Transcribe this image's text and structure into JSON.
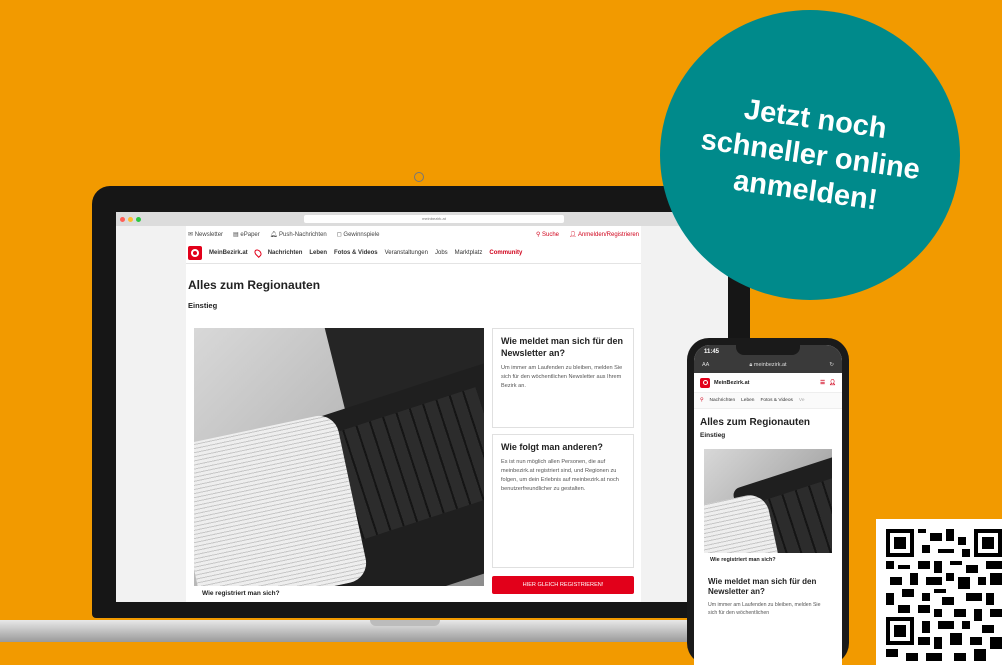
{
  "colors": {
    "background": "#f29a00",
    "badge": "#008a8b",
    "brand_red": "#e2001a"
  },
  "badge": {
    "line1": "Jetzt noch",
    "line2": "schneller online",
    "line3": "anmelden!"
  },
  "browser": {
    "url": "meinbezirk.at"
  },
  "site": {
    "topbar": {
      "newsletter": "Newsletter",
      "epaper": "ePaper",
      "push": "Push-Nachrichten",
      "gewinnspiele": "Gewinnspiele",
      "suche": "Suche",
      "anmelden": "Anmelden/Registrieren"
    },
    "logo": "MeinBezirk.at",
    "nav": [
      "Nachrichten",
      "Leben",
      "Fotos & Videos",
      "Veranstaltungen",
      "Jobs",
      "Marktplatz",
      "Community"
    ],
    "title": "Alles zum Regionauten",
    "subtitle": "Einstieg",
    "photo_caption": "Wie registriert man sich?",
    "card1": {
      "heading": "Wie meldet man sich für den Newsletter an?",
      "text": "Um immer am Laufenden zu bleiben, melden Sie sich für den wöchentlichen Newsletter aus Ihrem Bezirk an."
    },
    "card2": {
      "heading": "Wie folgt man anderen?",
      "text": "Es ist nun möglich allen Personen, die auf meinbezirk.at registriert sind, und Regionen zu folgen, um dein Erlebnis auf meinbezirk.at noch benutzerfreundlicher zu gestalten."
    },
    "register_button": "HIER GLEICH REGISTRIEREN!"
  },
  "phone": {
    "time": "11:45",
    "aa": "AA",
    "url": "meinbezirk.at",
    "logo": "MeinBezirk.at",
    "nav": [
      "Nachrichten",
      "Leben",
      "Fotos & Videos",
      "Ve"
    ],
    "title": "Alles zum Regionauten",
    "subtitle": "Einstieg",
    "photo_caption": "Wie registriert man sich?",
    "card_heading": "Wie meldet man sich für den Newsletter an?",
    "card_text": "Um immer am Laufenden zu bleiben, melden Sie sich für den wöchentlichen"
  }
}
